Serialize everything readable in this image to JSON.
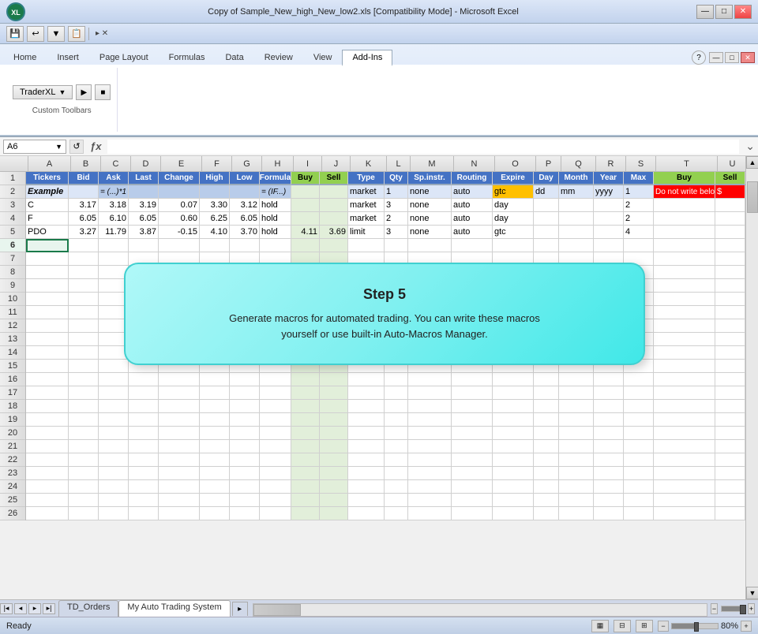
{
  "titlebar": {
    "title": "Copy of Sample_New_high_New_low2.xls [Compatibility Mode] - Microsoft Excel",
    "icon_text": "XL"
  },
  "quickaccess": {
    "buttons": [
      "💾",
      "↩",
      "↪",
      "📋",
      "⊞"
    ]
  },
  "ribbon": {
    "tabs": [
      "Home",
      "Insert",
      "Page Layout",
      "Formulas",
      "Data",
      "Review",
      "View",
      "Add-Ins"
    ],
    "active_tab": "Add-Ins",
    "traderxl_label": "TraderXL",
    "custom_toolbars_label": "Custom Toolbars"
  },
  "formula_bar": {
    "cell_ref": "A6",
    "formula": ""
  },
  "columns": [
    "A",
    "B",
    "C",
    "D",
    "E",
    "F",
    "G",
    "H",
    "I",
    "J",
    "K",
    "L",
    "M",
    "N",
    "O",
    "P",
    "Q",
    "R",
    "S",
    "T",
    "U",
    ""
  ],
  "col_headers": [
    "Tickers",
    "Bid",
    "Ask",
    "Last",
    "Change",
    "High",
    "Low",
    "Formula",
    "Buy",
    "Sell",
    "Type",
    "Qty",
    "Sp.instr.",
    "Routing",
    "Expire",
    "Day",
    "Month",
    "Year",
    "Max",
    "Buy",
    "Sell",
    ""
  ],
  "rows": {
    "1": {
      "label": "1",
      "cells": [
        "Tickers",
        "Bid",
        "Ask",
        "Last",
        "Change",
        "High",
        "Low",
        "Formula",
        "Buy",
        "Sell",
        "Type",
        "Qty",
        "Sp.instr.",
        "Routing",
        "Expire",
        "Day",
        "Month",
        "Year",
        "Max",
        "Buy",
        "Sell",
        ""
      ]
    },
    "2": {
      "label": "2",
      "cells": [
        "Example",
        "",
        "= (...)*1",
        "",
        "",
        "",
        "",
        "= (IF...)",
        "",
        "",
        "market",
        "1",
        "none",
        "auto",
        "gtc",
        "dd",
        "mm",
        "yyyy",
        "1",
        "Do not write below !",
        "$",
        ""
      ]
    },
    "3": {
      "label": "3",
      "cells": [
        "C",
        "3.17",
        "3.18",
        "3.19",
        "0.07",
        "3.30",
        "3.12",
        "hold",
        "",
        "",
        "market",
        "3",
        "none",
        "auto",
        "day",
        "",
        "",
        "",
        "2",
        "",
        "",
        ""
      ]
    },
    "4": {
      "label": "4",
      "cells": [
        "F",
        "6.05",
        "6.10",
        "6.05",
        "0.60",
        "6.25",
        "6.05",
        "hold",
        "",
        "",
        "market",
        "2",
        "none",
        "auto",
        "day",
        "",
        "",
        "",
        "2",
        "",
        "",
        ""
      ]
    },
    "5": {
      "label": "5",
      "cells": [
        "PDO",
        "3.27",
        "11.79",
        "3.87",
        "-0.15",
        "4.10",
        "3.70",
        "hold",
        "4.11",
        "3.69",
        "limit",
        "3",
        "none",
        "auto",
        "gtc",
        "",
        "",
        "",
        "4",
        "",
        "",
        ""
      ]
    },
    "6": {
      "label": "6",
      "cells": [
        "",
        "",
        "",
        "",
        "",
        "",
        "",
        "",
        "",
        "",
        "",
        "",
        "",
        "",
        "",
        "",
        "",
        "",
        "",
        "",
        "",
        ""
      ]
    },
    "7": {
      "label": "7",
      "cells": []
    },
    "8": {
      "label": "8",
      "cells": []
    },
    "9": {
      "label": "9",
      "cells": []
    },
    "10": {
      "label": "10",
      "cells": []
    },
    "11": {
      "label": "11",
      "cells": []
    },
    "12": {
      "label": "12",
      "cells": []
    },
    "13": {
      "label": "13",
      "cells": []
    },
    "14": {
      "label": "14",
      "cells": []
    },
    "15": {
      "label": "15",
      "cells": []
    },
    "16": {
      "label": "16",
      "cells": []
    },
    "17": {
      "label": "17",
      "cells": []
    },
    "18": {
      "label": "18",
      "cells": []
    },
    "19": {
      "label": "19",
      "cells": []
    },
    "20": {
      "label": "20",
      "cells": []
    },
    "21": {
      "label": "21",
      "cells": []
    },
    "22": {
      "label": "22",
      "cells": []
    },
    "23": {
      "label": "23",
      "cells": []
    },
    "24": {
      "label": "24",
      "cells": []
    },
    "25": {
      "label": "25",
      "cells": []
    },
    "26": {
      "label": "26",
      "cells": []
    }
  },
  "popup": {
    "title": "Step 5",
    "text_line1": "Generate macros for automated trading. You can write these macros",
    "text_line2": "yourself or use built-in Auto-Macros Manager."
  },
  "sheet_tabs": [
    "TD_Orders",
    "My Auto Trading System"
  ],
  "active_tab": "My Auto Trading System",
  "status": {
    "ready": "Ready",
    "zoom": "80%"
  }
}
